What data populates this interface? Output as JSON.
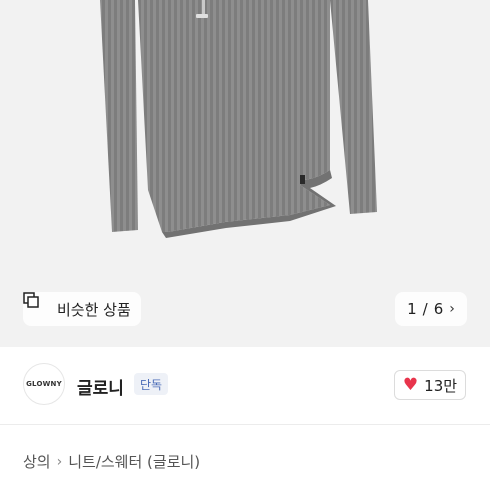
{
  "gallery": {
    "similar_label": "비슷한 상품",
    "current_page": "1",
    "page_separator": "/",
    "total_pages": "6"
  },
  "brand": {
    "logo_text": "GLOWNY",
    "name": "글로니",
    "badge": "단독",
    "like_count": "13만"
  },
  "breadcrumb": {
    "items": [
      "상의",
      "니트/스웨터 (글로니)"
    ]
  },
  "colors": {
    "heart": "#e8344c",
    "badge_text": "#4b6cb7",
    "badge_bg": "#eef1f7"
  }
}
